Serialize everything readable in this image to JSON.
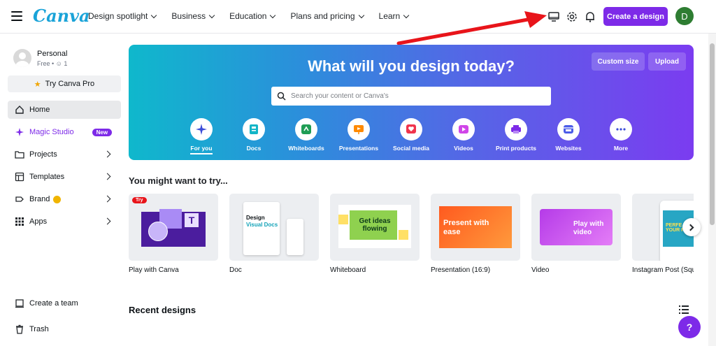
{
  "brand": {
    "logo": "Canva",
    "accent": "#7d2ae8",
    "logo_color": "#1aa3d8"
  },
  "nav": [
    "Design spotlight",
    "Business",
    "Education",
    "Plans and pricing",
    "Learn"
  ],
  "header": {
    "create_label": "Create a design",
    "avatar_letter": "D",
    "icons": [
      "desktop-icon",
      "gear-icon",
      "bell-icon"
    ]
  },
  "profile": {
    "name": "Personal",
    "plan": "Free",
    "members": "1",
    "try_pro": "Try Canva Pro"
  },
  "sidebar": {
    "items": [
      {
        "label": "Home",
        "icon": "home-icon"
      },
      {
        "label": "Magic Studio",
        "icon": "sparkle-icon",
        "badge": "New"
      },
      {
        "label": "Projects",
        "icon": "folder-icon"
      },
      {
        "label": "Templates",
        "icon": "template-icon"
      },
      {
        "label": "Brand",
        "icon": "brand-icon"
      },
      {
        "label": "Apps",
        "icon": "apps-icon"
      }
    ],
    "create_team": "Create a team",
    "trash": "Trash"
  },
  "hero": {
    "title": "What will you design today?",
    "custom_size": "Custom size",
    "upload": "Upload",
    "search_placeholder": "Search your content or Canva's",
    "categories": [
      "For you",
      "Docs",
      "Whiteboards",
      "Presentations",
      "Social media",
      "Videos",
      "Print products",
      "Websites",
      "More"
    ]
  },
  "suggestions": {
    "title": "You might want to try...",
    "cards": [
      {
        "label": "Play with Canva",
        "tag": "Try"
      },
      {
        "label": "Doc",
        "thumb_a": "Design",
        "thumb_b": "Visual Docs"
      },
      {
        "label": "Whiteboard",
        "thumb_text": "Get ideas flowing"
      },
      {
        "label": "Presentation (16:9)",
        "thumb_text": "Present with ease"
      },
      {
        "label": "Video",
        "thumb_text": "Play with video"
      },
      {
        "label": "Instagram Post (Squ",
        "thumb_text": "PERFE YOUR P"
      }
    ]
  },
  "recent": {
    "title": "Recent designs"
  },
  "help_label": "?"
}
